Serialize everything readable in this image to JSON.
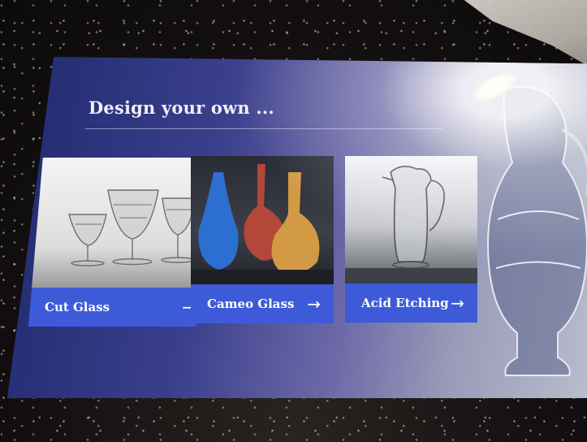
{
  "header": {
    "title": "Design your own ..."
  },
  "cards": [
    {
      "label": "Cut Glass",
      "arrow": "→",
      "icon": "arrow-right-icon"
    },
    {
      "label": "Cameo Glass",
      "arrow": "→",
      "icon": "arrow-right-icon"
    },
    {
      "label": "Acid Etching",
      "arrow": "→",
      "icon": "arrow-right-icon"
    }
  ],
  "colors": {
    "background_deep": "#1f2a6e",
    "background_light": "#b9bccb",
    "card_bar": "#3d5bd8",
    "title_text": "#f1eef6"
  }
}
